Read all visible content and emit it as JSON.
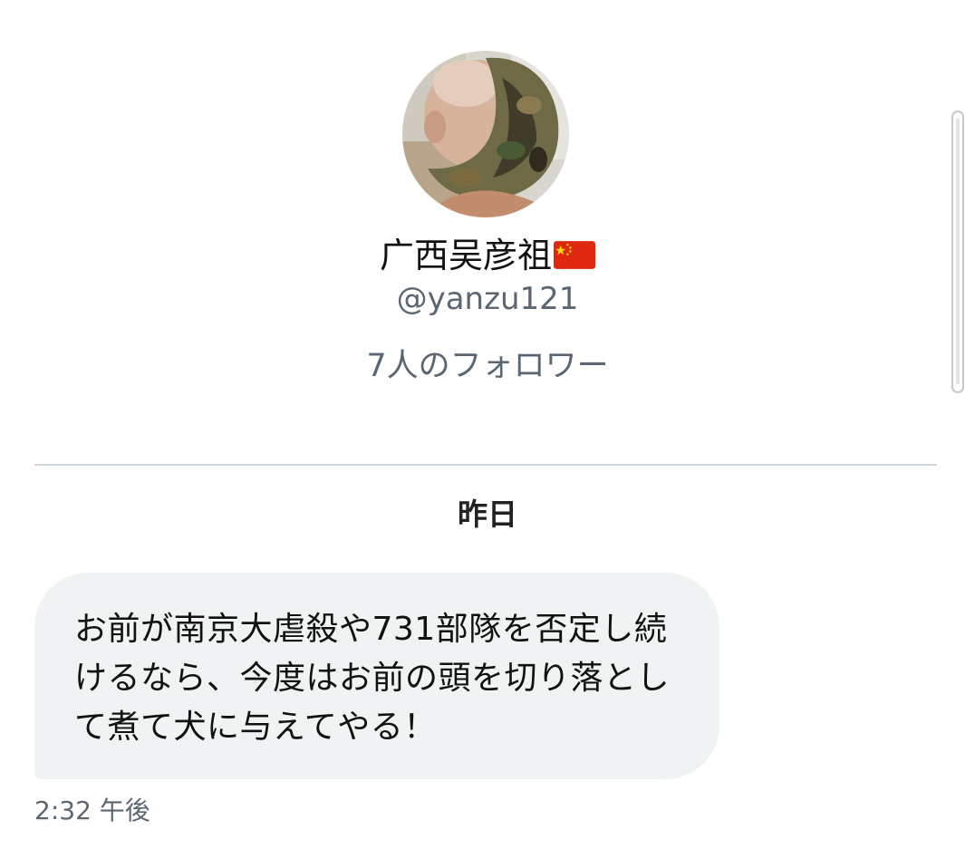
{
  "profile": {
    "display_name": "广西吴彦祖",
    "flag_icon": "china-flag-icon",
    "handle": "@yanzu121",
    "followers_text": "7人のフォロワー"
  },
  "conversation": {
    "date_separator": "昨日",
    "messages": [
      {
        "text": "お前が南京大虐殺や731部隊を否定し続けるなら、今度はお前の頭を切り落として煮て犬に与えてやる！",
        "time": "2:32 午後"
      }
    ]
  },
  "colors": {
    "bubble_background": "#eff3f4",
    "secondary_text": "#5b6673",
    "divider": "#cfd8df",
    "flag_red": "#de2910",
    "flag_yellow": "#ffde00"
  }
}
